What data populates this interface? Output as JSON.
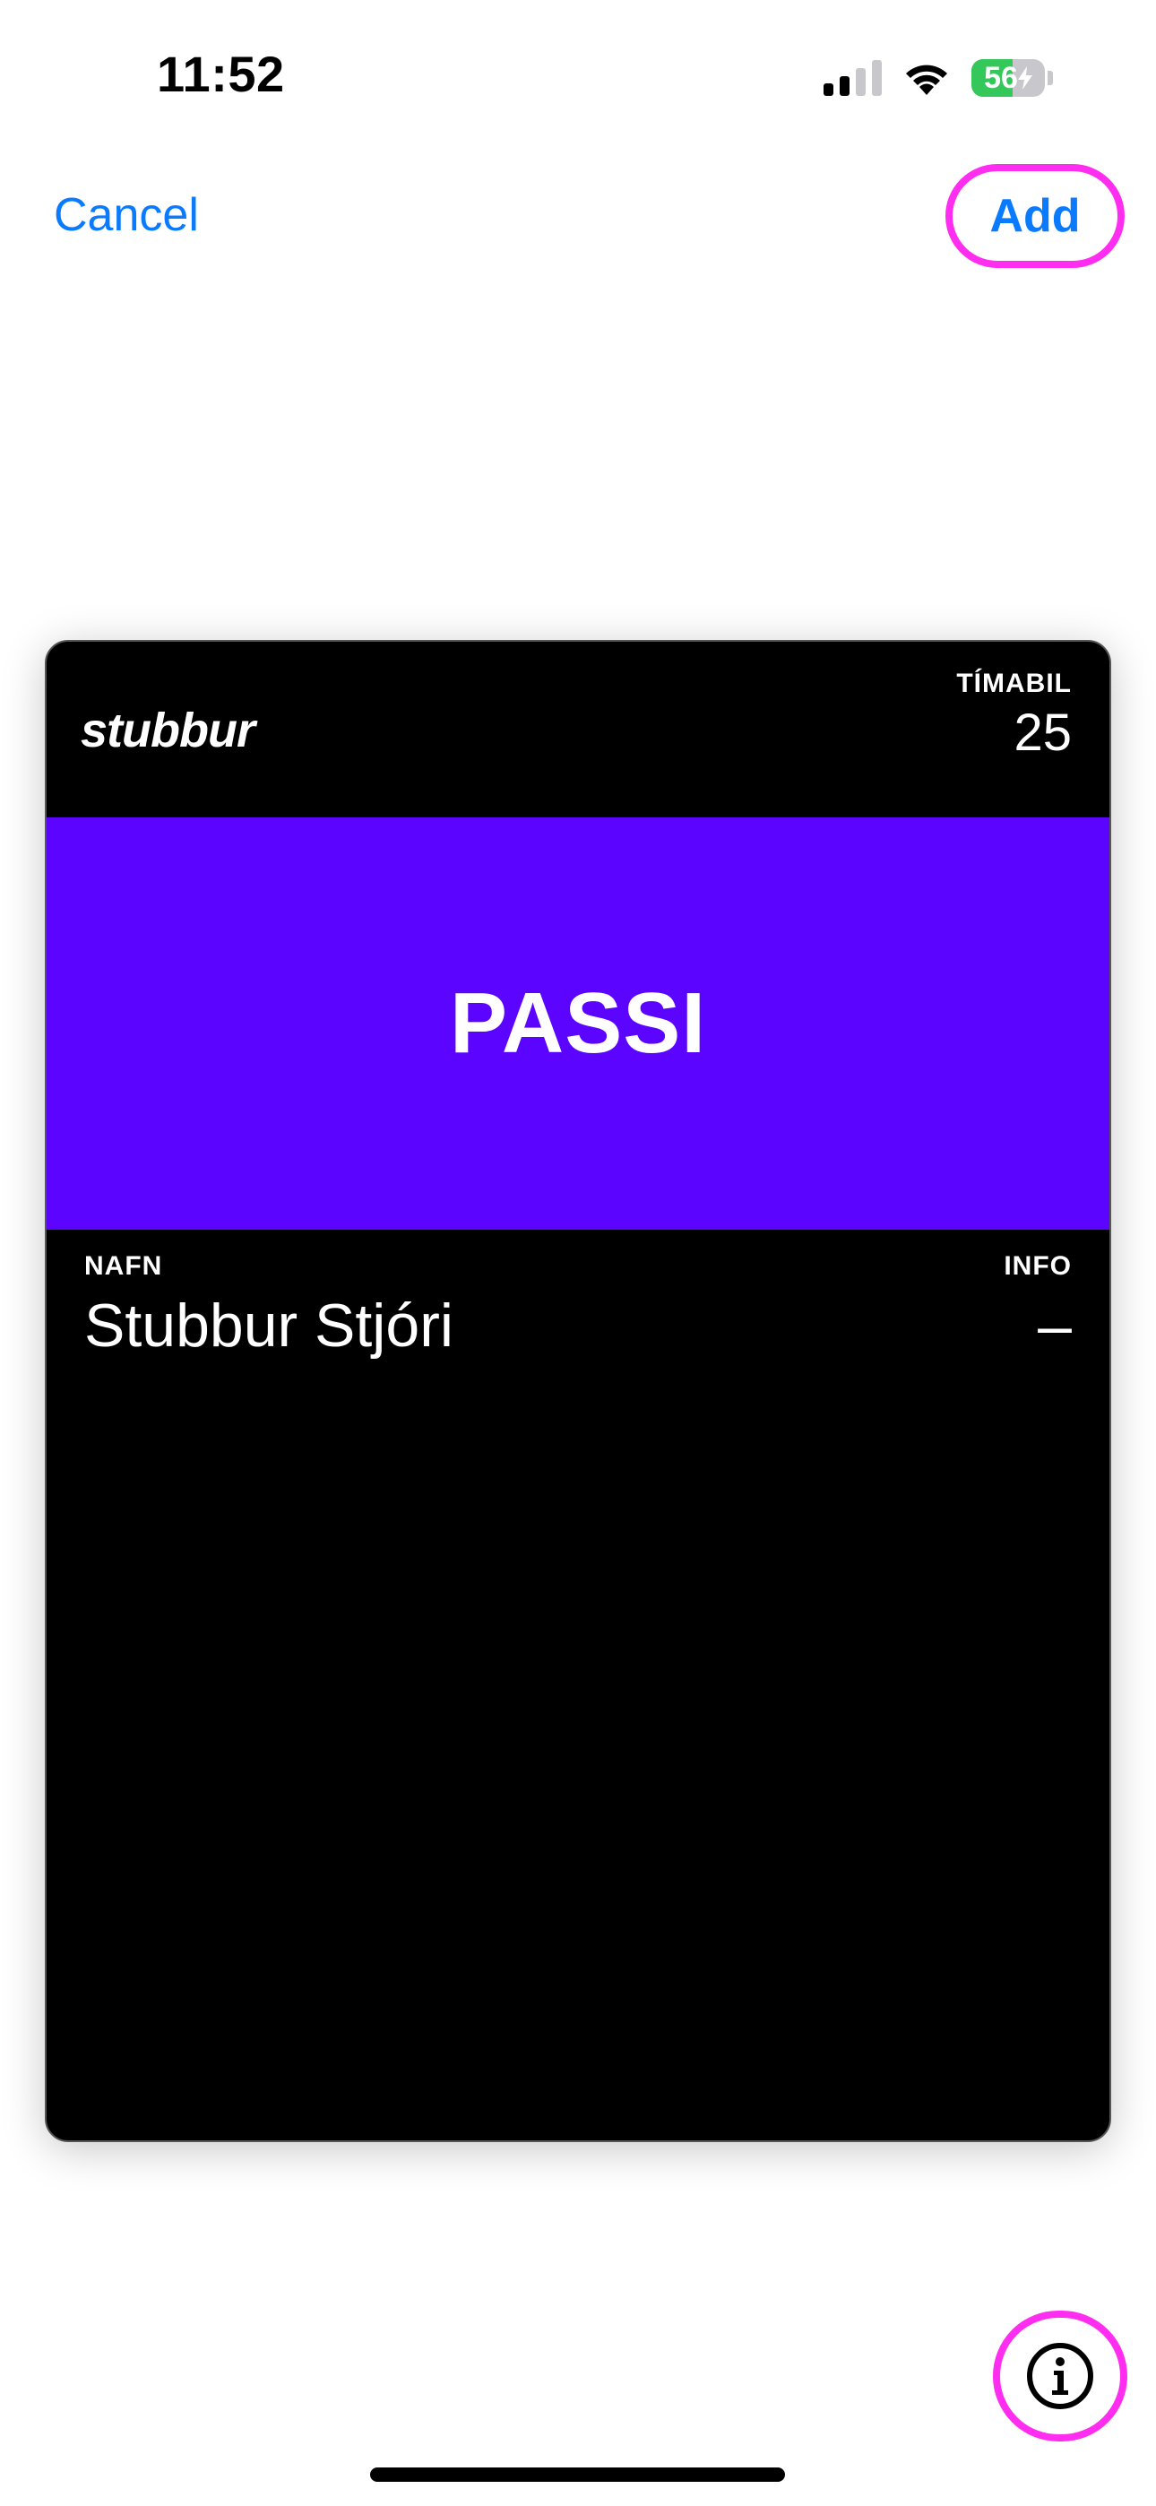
{
  "status_bar": {
    "time": "11:52",
    "battery_level": "56",
    "battery_fraction": 0.56,
    "signal_bars_active": 2,
    "signal_bars_total": 4
  },
  "nav": {
    "cancel_label": "Cancel",
    "add_label": "Add"
  },
  "pass": {
    "logo_text": "stubbur",
    "header_field": {
      "label": "TÍMABIL",
      "value": "25"
    },
    "strip_text": "PASSI",
    "strip_color": "#5b04ff",
    "primary_fields": [
      {
        "label": "NAFN",
        "value": "Stubbur Stjóri"
      },
      {
        "label": "INFO",
        "value": "–"
      }
    ]
  },
  "colors": {
    "accent": "#0a7aff",
    "highlight_ring": "#ff2df0",
    "battery_green": "#34c759"
  },
  "icons": {
    "info": "info-circle-icon",
    "wifi": "wifi-icon",
    "signal": "cellular-signal-icon",
    "battery": "battery-charging-icon"
  }
}
